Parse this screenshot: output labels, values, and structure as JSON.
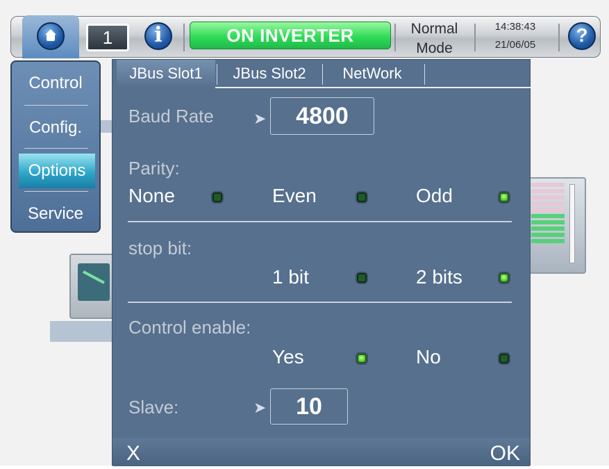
{
  "topbar": {
    "wave_label": "1",
    "info_label": "i",
    "status": "ON INVERTER",
    "mode_line1": "Normal",
    "mode_line2": "Mode",
    "time": "14:38:43",
    "date": "21/06/05",
    "help_label": "?",
    "status_color": "#2fdc57"
  },
  "sidemenu": {
    "items": [
      {
        "label": "Control"
      },
      {
        "label": "Config."
      },
      {
        "label": "Options",
        "active": true
      },
      {
        "label": "Service"
      }
    ]
  },
  "dialog": {
    "tabs": [
      {
        "label": "JBus Slot1",
        "active": true
      },
      {
        "label": "JBus Slot2"
      },
      {
        "label": "NetWork"
      }
    ],
    "baud_rate": {
      "label": "Baud Rate",
      "value": "4800"
    },
    "parity": {
      "label": "Parity:",
      "options": [
        {
          "label": "None",
          "selected": false
        },
        {
          "label": "Even",
          "selected": false
        },
        {
          "label": "Odd",
          "selected": true
        }
      ]
    },
    "stop_bit": {
      "label": "stop bit:",
      "options": [
        {
          "label": "1 bit",
          "selected": false
        },
        {
          "label": "2 bits",
          "selected": true
        }
      ]
    },
    "control_enable": {
      "label": "Control enable:",
      "options": [
        {
          "label": "Yes",
          "selected": true
        },
        {
          "label": "No",
          "selected": false
        }
      ]
    },
    "slave": {
      "label": "Slave:",
      "value": "10"
    },
    "footer": {
      "cancel_label": "X",
      "ok_label": "OK"
    }
  }
}
